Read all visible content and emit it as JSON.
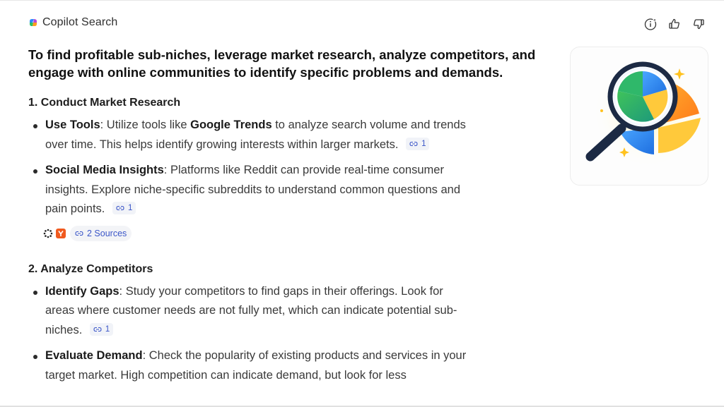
{
  "brand": {
    "name": "Copilot Search"
  },
  "actions": [
    {
      "name": "info-sparkle-icon"
    },
    {
      "name": "thumbs-up-icon"
    },
    {
      "name": "thumbs-down-icon"
    }
  ],
  "answer": {
    "headline": "To find profitable sub-niches, leverage market research, analyze competitors, and engage with online communities to identify specific problems and demands.",
    "sections": [
      {
        "title": "1. Conduct Market Research",
        "items": [
          {
            "bold": "Use Tools",
            "pre": ": Utilize tools like ",
            "bold2": "Google Trends",
            "post": " to analyze search volume and trends over time. This helps identify growing interests within larger markets.",
            "cite": "1"
          },
          {
            "bold": "Social Media Insights",
            "text": ": Platforms like Reddit can provide real-time consumer insights. Explore niche-specific subreddits to understand common questions and pain points.",
            "cite": "1"
          }
        ],
        "sources_label": "2 Sources"
      },
      {
        "title": "2. Analyze Competitors",
        "items": [
          {
            "bold": "Identify Gaps",
            "text": ": Study your competitors to find gaps in their offerings. Look for areas where customer needs are not fully met, which can indicate potential sub-niches.",
            "cite": "1"
          },
          {
            "bold": "Evaluate Demand",
            "text": ": Check the popularity of existing products and services in your target market. High competition can indicate demand, but look for less"
          }
        ]
      }
    ]
  },
  "colors": {
    "cite_text": "#3b56c8",
    "cite_bg": "#f1f3f8",
    "heading": "#111111"
  },
  "image": {
    "icon": "magnifier-pie-chart-icon"
  }
}
